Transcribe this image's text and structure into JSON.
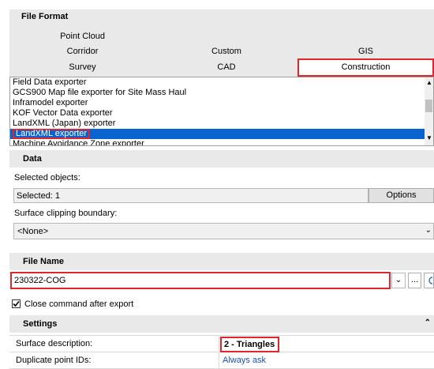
{
  "file_format": {
    "title": "File Format",
    "tabs_row1": [
      "Point Cloud"
    ],
    "tabs_row2": [
      "Corridor",
      "Custom",
      "GIS"
    ],
    "tabs_row3": [
      "Survey",
      "CAD",
      "Construction"
    ],
    "exporters": [
      "Field Data exporter",
      "GCS900 Map file exporter for Site Mass Haul",
      "Inframodel exporter",
      "KOF Vector Data exporter",
      "LandXML (Japan) exporter",
      "LandXML exporter",
      "Machine Avoidance Zone exporter"
    ],
    "selected_exporter": "LandXML exporter"
  },
  "data": {
    "title": "Data",
    "selected_objects_label": "Selected objects:",
    "selected_value": "Selected: 1",
    "options_label": "Options",
    "surface_clipping_label": "Surface clipping boundary:",
    "surface_clipping_value": "<None>"
  },
  "file_name": {
    "title": "File Name",
    "value": "230322-COG",
    "browse_label": "..."
  },
  "close_after_export": {
    "label": "Close command after export",
    "checked": true
  },
  "settings": {
    "title": "Settings",
    "rows": [
      {
        "label": "Surface description:",
        "value": "2 - Triangles"
      },
      {
        "label": "Duplicate point IDs:",
        "value": "Always ask"
      }
    ]
  },
  "colors": {
    "highlight": "#e0262d",
    "selection": "#0a64d0",
    "link": "#1a4fb5",
    "section_bg": "#e9e9e9"
  },
  "icons": [
    "chevron-down-icon",
    "scroll-up-icon",
    "scroll-down-icon",
    "collapse-icon",
    "checkbox-icon"
  ]
}
